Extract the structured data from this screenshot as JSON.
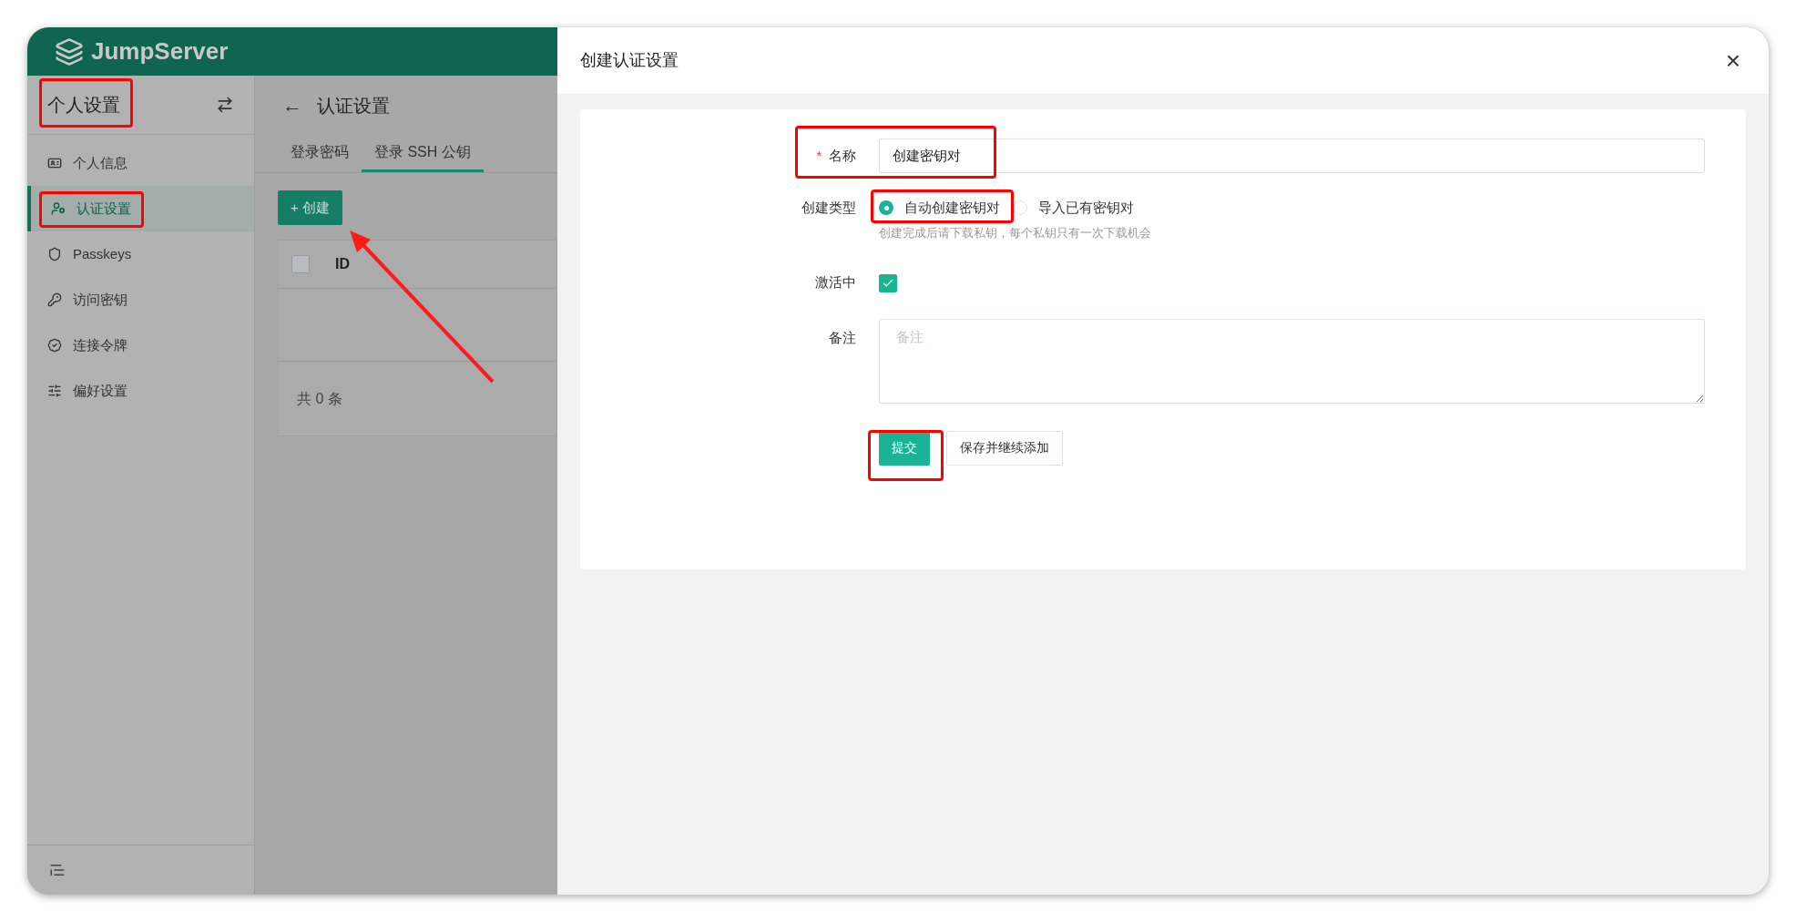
{
  "brand": {
    "name": "JumpServer"
  },
  "sidebar": {
    "title": "个人设置",
    "items": [
      {
        "label": "个人信息",
        "selected": false
      },
      {
        "label": "认证设置",
        "selected": true
      },
      {
        "label": "Passkeys",
        "selected": false
      },
      {
        "label": "访问密钥",
        "selected": false
      },
      {
        "label": "连接令牌",
        "selected": false
      },
      {
        "label": "偏好设置",
        "selected": false
      }
    ]
  },
  "page": {
    "back": "←",
    "title": "认证设置",
    "tabs": [
      {
        "label": "登录密码",
        "selected": false
      },
      {
        "label": "登录 SSH 公钥",
        "selected": true
      }
    ],
    "create_button": "+ 创建",
    "table": {
      "columns": [
        "ID"
      ],
      "select_all_checked": false
    },
    "total": "共 0 条"
  },
  "drawer": {
    "title": "创建认证设置",
    "close": "×",
    "form": {
      "name": {
        "label": "名称",
        "required_mark": "*",
        "value": "创建密钥对"
      },
      "create_type": {
        "label": "创建类型",
        "options": [
          {
            "label": "自动创建密钥对",
            "selected": true
          },
          {
            "label": "导入已有密钥对",
            "selected": false
          }
        ],
        "hint": "创建完成后请下载私钥，每个私钥只有一次下载机会"
      },
      "active": {
        "label": "激活中",
        "checked": true
      },
      "comment": {
        "label": "备注",
        "placeholder": "备注"
      },
      "buttons": [
        {
          "label": "提交",
          "kind": "primary"
        },
        {
          "label": "保存并继续添加",
          "kind": "default"
        }
      ]
    }
  }
}
